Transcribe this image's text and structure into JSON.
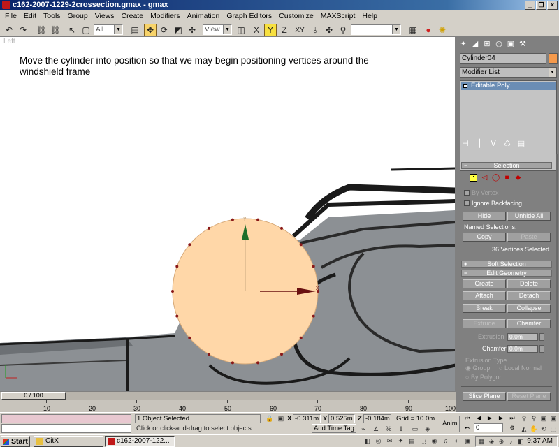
{
  "window": {
    "title": "c162-2007-1229-2crossection.gmax - gmax",
    "min": "_",
    "max": "❐",
    "close": "×"
  },
  "menu": [
    "File",
    "Edit",
    "Tools",
    "Group",
    "Views",
    "Create",
    "Modifiers",
    "Animation",
    "Graph Editors",
    "Customize",
    "MAXScript",
    "Help"
  ],
  "toolbar": {
    "filter": "All",
    "refcoord": "View",
    "namedsel": ""
  },
  "viewport": {
    "label": "Left",
    "caption": "Move the cylinder into position so that we may begin positioning vertices around the windshield frame",
    "gizmo_y": "y",
    "gizmo_x": "x"
  },
  "timeslider": {
    "label": "0 / 100"
  },
  "trackbar": {
    "ticks": [
      "10",
      "20",
      "30",
      "40",
      "50",
      "60",
      "70",
      "80",
      "90",
      "100"
    ]
  },
  "panel": {
    "object_name": "Cylinder04",
    "modifier_list": "Modifier List",
    "stack_item": "Editable Poly",
    "selection_title": "Selection",
    "by_vertex": "By Vertex",
    "ignore_backfacing": "Ignore Backfacing",
    "hide": "Hide",
    "unhide_all": "Unhide All",
    "named_selections": "Named Selections:",
    "copy": "Copy",
    "paste": "Paste",
    "selected_info": "36 Vertices Selected",
    "soft_selection": "Soft Selection",
    "edit_geometry": "Edit Geometry",
    "create": "Create",
    "delete": "Delete",
    "attach": "Attach",
    "detach": "Detach",
    "break": "Break",
    "collapse": "Collapse",
    "extrude": "Extrude",
    "chamfer": "Chamfer",
    "extrusion_label": "Extrusion",
    "extrusion_value": "0.0m",
    "chamfer_label": "Chamfer",
    "chamfer_value": "0.0m",
    "extrusion_type": "Extrusion Type",
    "group": "Group",
    "local_normal": "Local Normal",
    "by_polygon": "By Polygon",
    "slice_plane": "Slice Plane",
    "reset_plane": "Reset Plane",
    "accent_color": "#f59a4c"
  },
  "status": {
    "selected": "1 Object Selected",
    "prompt": "Click or click-and-drag to select objects",
    "x_label": "X",
    "x": "-0.311m",
    "y_label": "Y",
    "y": "0.525m",
    "z_label": "Z",
    "z": "-0.184m",
    "grid": "Grid = 10.0m",
    "add_time_tag": "Add Time Tag",
    "anim": "Anim.",
    "frame": "0"
  },
  "taskbar": {
    "start": "Start",
    "tasks": [
      "CitX",
      "c162-2007-122..."
    ],
    "clock": "9:37 AM"
  }
}
